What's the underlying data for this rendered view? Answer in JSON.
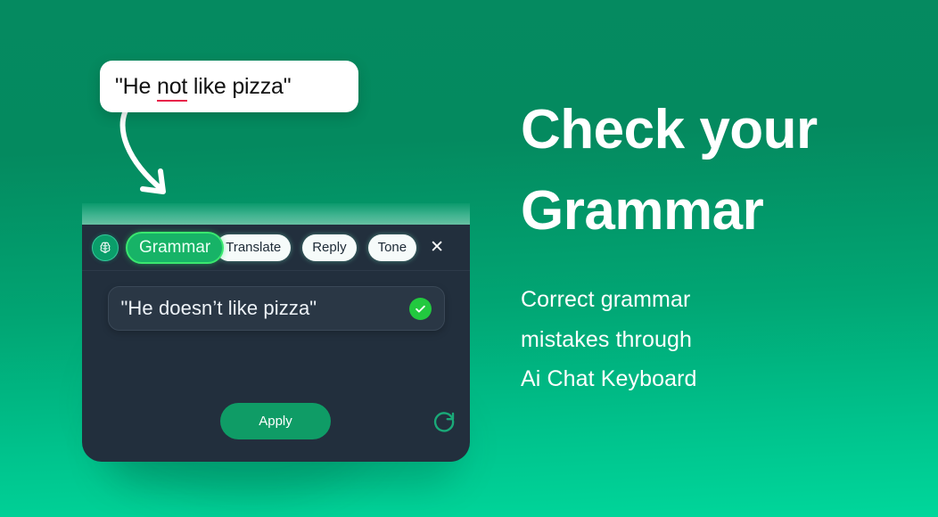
{
  "background": {
    "gradient_top": "#058a60",
    "gradient_bottom": "#00d79b"
  },
  "bubble": {
    "name": "original-text-bubble",
    "prefix": "\"He ",
    "error_word": "not",
    "suffix": " like pizza\"",
    "full_text": "\"He not like pizza\"",
    "error_underline_color": "#e8234a"
  },
  "app_panel": {
    "background": "#222f3d",
    "toolbar": {
      "brain_icon": "brain-icon",
      "tabs": [
        {
          "label": "Grammar",
          "active": true
        },
        {
          "label": "Translate",
          "active": false
        },
        {
          "label": "Reply",
          "active": false
        },
        {
          "label": "Tone",
          "active": false
        }
      ],
      "close_label": "✕",
      "active_color": "#17b367",
      "active_border": "#3ae86f"
    },
    "result": {
      "text": "\"He doesn’t like pizza\"",
      "status_icon": "check-circle-icon",
      "status_color": "#22c93f"
    },
    "actions": {
      "apply_label": "Apply",
      "apply_color": "#0f9c66",
      "refresh_icon": "refresh-icon",
      "refresh_color": "#1aa978"
    }
  },
  "copy": {
    "headline_line1": "Check your",
    "headline_line2": "Grammar",
    "body_line1": "Correct grammar",
    "body_line2": "mistakes through",
    "body_line3": "Ai Chat Keyboard"
  }
}
